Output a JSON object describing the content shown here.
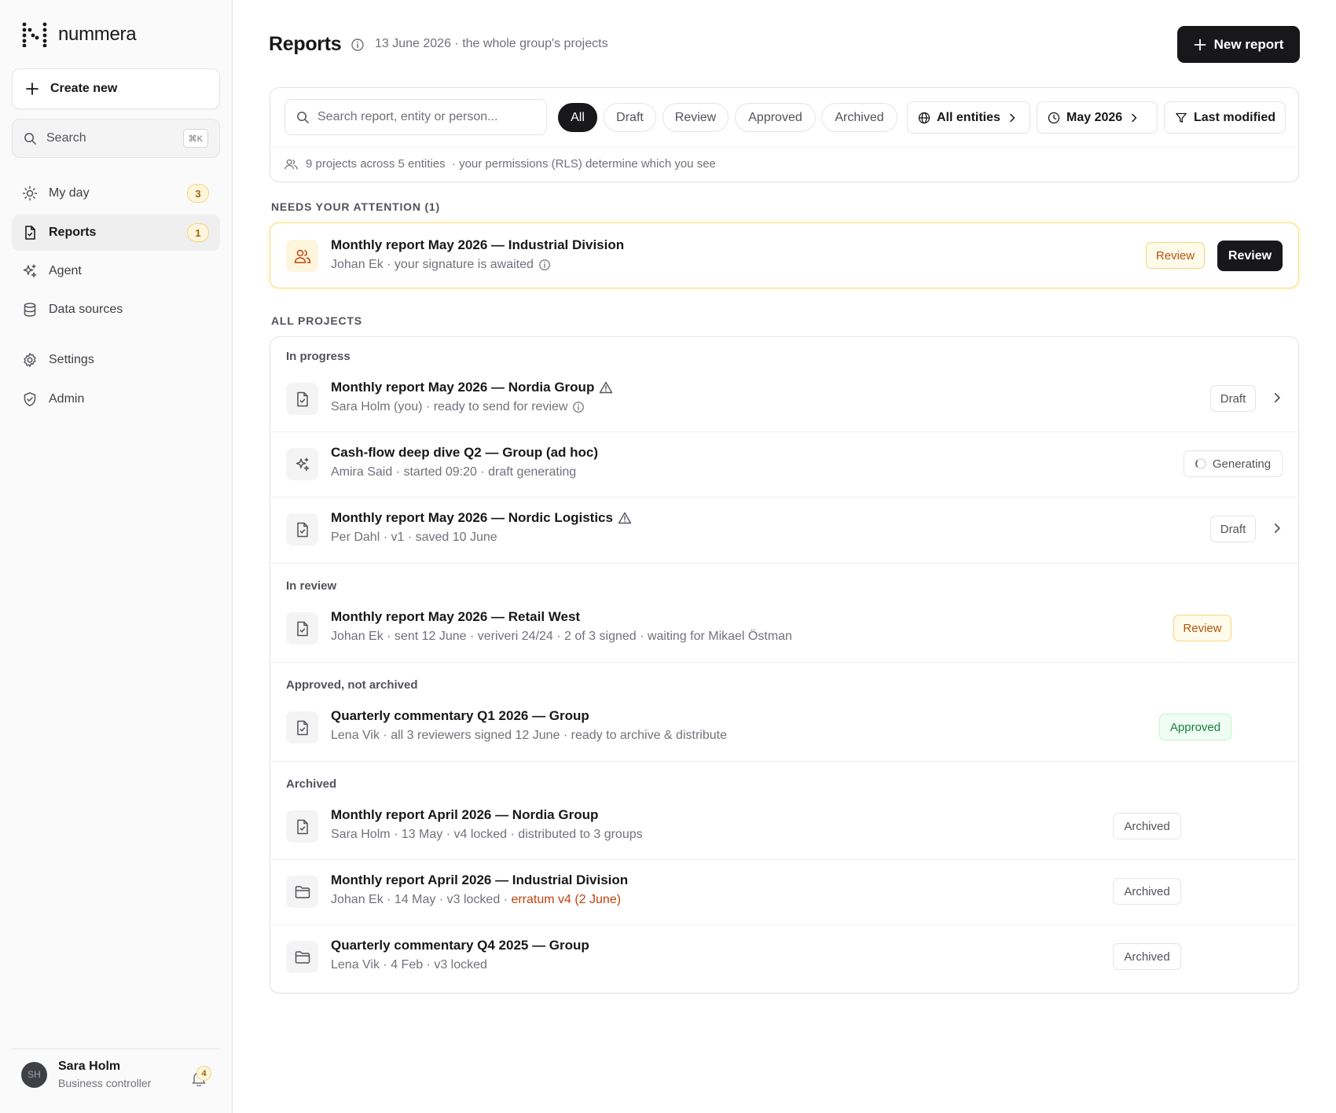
{
  "sidebar": {
    "brand": "nummera",
    "create_new": "Create new",
    "search_label": "Search",
    "search_shortcut": "⌘K",
    "nav": [
      {
        "label": "My day",
        "icon": "sun-icon",
        "badge": "3"
      },
      {
        "label": "Reports",
        "icon": "document-icon",
        "badge": "1",
        "active": true
      },
      {
        "label": "Agent",
        "icon": "sparkles-icon"
      },
      {
        "label": "Data sources",
        "icon": "database-icon"
      },
      {
        "label": "Settings",
        "icon": "gear-icon"
      },
      {
        "label": "Admin",
        "icon": "shield-icon"
      }
    ],
    "user": {
      "initials": "SH",
      "name": "Sara Holm",
      "role": "Business controller",
      "notifications": "4"
    }
  },
  "header": {
    "title": "Reports",
    "subtitle": "13 June 2026 · the whole group's projects",
    "new_report": "New report"
  },
  "filters": {
    "search_placeholder": "Search report, entity or person...",
    "chips": [
      "All",
      "Draft",
      "Review",
      "Approved",
      "Archived"
    ],
    "active_chip": "All",
    "entities": "All entities",
    "period": "May 2026",
    "sort": "Last modified",
    "info": "9 projects across 5 entities  · your permissions (RLS) determine which you see"
  },
  "attention": {
    "label": "NEEDS YOUR ATTENTION (1)",
    "title": "Monthly report May 2026 — Industrial Division",
    "subtitle": "Johan Ek · your signature is awaited",
    "status": "Review",
    "action": "Review"
  },
  "projects": {
    "label": "ALL PROJECTS",
    "groups": [
      {
        "label": "In progress",
        "rows": [
          {
            "title": "Monthly report May 2026 — Nordia Group",
            "subtitle": "Sara Holm (you) · ready to send for review",
            "status": "Draft",
            "icon": "document-check-icon",
            "warning": true
          },
          {
            "title": "Cash-flow deep dive Q2 — Group (ad hoc)",
            "subtitle": "Amira Said · started 09:20 · draft generating",
            "status": "Generating",
            "icon": "sparkles-icon"
          },
          {
            "title": "Monthly report May 2026 — Nordic Logistics",
            "subtitle": "Per Dahl · v1 · saved 10 June",
            "status": "Draft",
            "icon": "document-check-icon",
            "warning": true
          }
        ]
      },
      {
        "label": "In review",
        "rows": [
          {
            "title": "Monthly report May 2026 — Retail West",
            "subtitle": "Johan Ek · sent 12 June · veriveri 24/24 · 2 of 3 signed · waiting for Mikael Östman",
            "status": "Review",
            "icon": "document-check-icon"
          }
        ]
      },
      {
        "label": "Approved, not archived",
        "rows": [
          {
            "title": "Quarterly commentary Q1 2026 — Group",
            "subtitle": "Lena Vik · all 3 reviewers signed 12 June · ready to archive & distribute",
            "status": "Approved",
            "icon": "document-check-icon"
          }
        ]
      },
      {
        "label": "Archived",
        "rows": [
          {
            "title": "Monthly report April 2026 — Nordia Group",
            "subtitle": "Sara Holm · 13 May · v4 locked · distributed to 3 groups",
            "status": "Archived",
            "icon": "document-check-icon"
          },
          {
            "title": "Monthly report April 2026 — Industrial Division",
            "subtitle": "Johan Ek · 14 May · v3 locked · ",
            "subtitle_highlight": "erratum v4 (2 June)",
            "status": "Archived",
            "icon": "folder-icon"
          },
          {
            "title": "Quarterly commentary Q4 2025 — Group",
            "subtitle": "Lena Vik · 4 Feb · v3 locked",
            "status": "Archived",
            "icon": "folder-icon"
          }
        ]
      }
    ]
  },
  "colors": {
    "accent_dark": "#18181b",
    "review": "#b45309",
    "approved": "#15803d",
    "erratum": "#c2410c",
    "badge_bg": "#fef6dc"
  }
}
